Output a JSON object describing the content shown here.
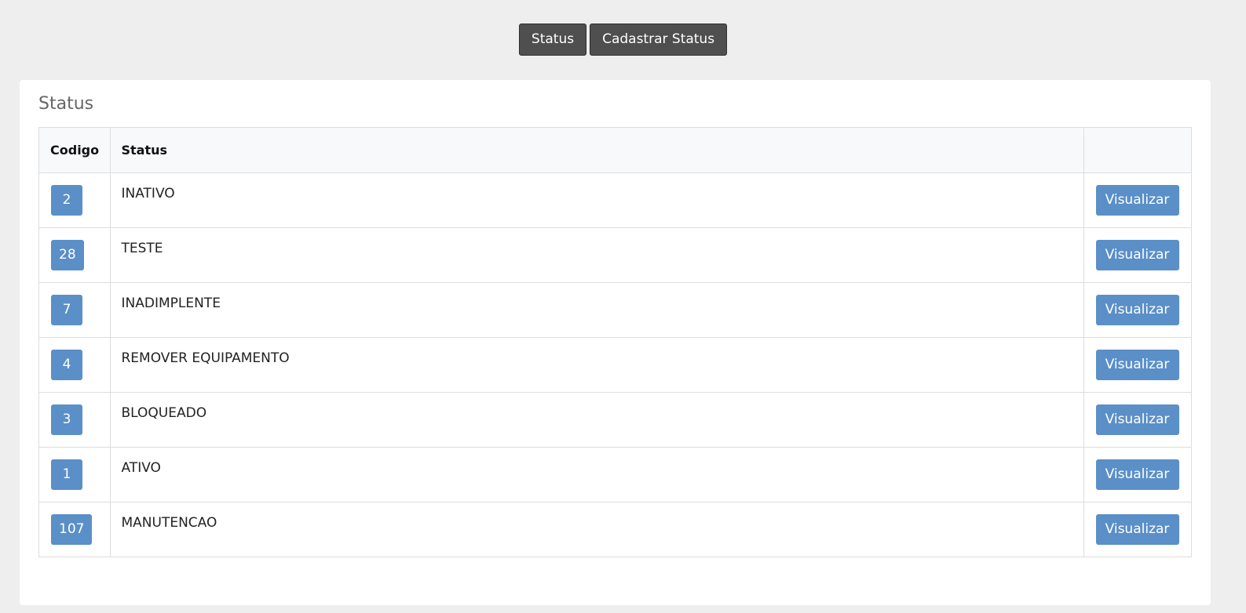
{
  "topnav": {
    "status_label": "Status",
    "register_label": "Cadastrar Status"
  },
  "panel": {
    "title": "Status"
  },
  "table": {
    "headers": {
      "code": "Codigo",
      "status": "Status",
      "action": ""
    },
    "rows": [
      {
        "code": "2",
        "status": "INATIVO",
        "action": "Visualizar"
      },
      {
        "code": "28",
        "status": "TESTE",
        "action": "Visualizar"
      },
      {
        "code": "7",
        "status": "INADIMPLENTE",
        "action": "Visualizar"
      },
      {
        "code": "4",
        "status": "REMOVER EQUIPAMENTO",
        "action": "Visualizar"
      },
      {
        "code": "3",
        "status": "BLOQUEADO",
        "action": "Visualizar"
      },
      {
        "code": "1",
        "status": "ATIVO",
        "action": "Visualizar"
      },
      {
        "code": "107",
        "status": "MANUTENCAO",
        "action": "Visualizar"
      }
    ]
  },
  "colors": {
    "nav_button": "#4f4f4f",
    "accent": "#5b8fc7",
    "background": "#eeeeee"
  }
}
